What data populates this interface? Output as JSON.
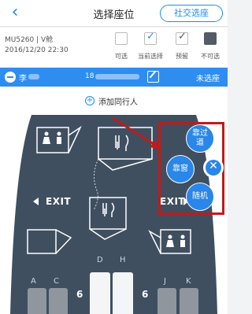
{
  "nav": {
    "back_icon": "chevron-left-icon",
    "title": "选择座位",
    "social_button": "社交选座"
  },
  "flight": {
    "line1": "MU5260 | V舱",
    "line2": "2016/12/20 22:30"
  },
  "legend": [
    {
      "label": "可选",
      "icon": "seat-available-icon"
    },
    {
      "label": "当前选择",
      "icon": "seat-current-icon"
    },
    {
      "label": "预留",
      "icon": "seat-reserved-icon"
    },
    {
      "label": "不可选",
      "icon": "seat-unavailable-icon"
    }
  ],
  "passenger": {
    "name": "李",
    "id_prefix": "18",
    "status": "未选座"
  },
  "add_companion": {
    "label": "添加同行人"
  },
  "cabin": {
    "exit_left": "EXIT",
    "exit_right": "EXIT",
    "columns_left": [
      "A",
      "C"
    ],
    "columns_center": [
      "D",
      "H"
    ],
    "columns_right": [
      "J",
      "K"
    ],
    "row_number": "6",
    "colors": {
      "fuselage": "#3f4f60",
      "seat_gray": "#8f969e",
      "seat_white": "#f4f5f6",
      "accent": "#2a86e8",
      "highlight": "#c01b1b"
    }
  },
  "seat_menu": {
    "aisle": "靠过道",
    "window": "靠窗",
    "random": "随机",
    "close_icon": "close-icon"
  }
}
